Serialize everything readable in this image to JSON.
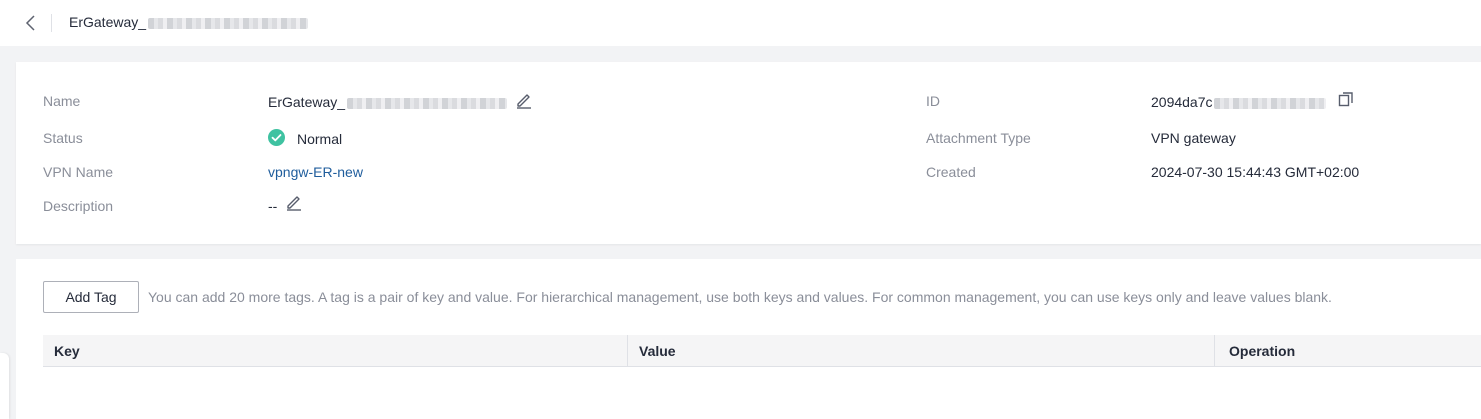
{
  "header": {
    "back_icon": "chevron-left-icon",
    "title": "ErGateway_"
  },
  "details": {
    "name_label": "Name",
    "name_value": "ErGateway_",
    "status_label": "Status",
    "status_value": "Normal",
    "status_color": "#3fc2a1",
    "vpn_name_label": "VPN Name",
    "vpn_name_value": "vpngw-ER-new",
    "description_label": "Description",
    "description_value": "--",
    "id_label": "ID",
    "id_value": "2094da7c",
    "attachment_type_label": "Attachment Type",
    "attachment_type_value": "VPN gateway",
    "created_label": "Created",
    "created_value": "2024-07-30 15:44:43 GMT+02:00"
  },
  "tags": {
    "add_tag_label": "Add Tag",
    "hint": "You can add 20 more tags. A tag is a pair of key and value. For hierarchical management, use both keys and values. For common management, you can use keys only and leave values blank.",
    "columns": [
      "Key",
      "Value",
      "Operation"
    ]
  },
  "colors": {
    "link": "#1f5d9c",
    "background": "#f2f3f5"
  }
}
